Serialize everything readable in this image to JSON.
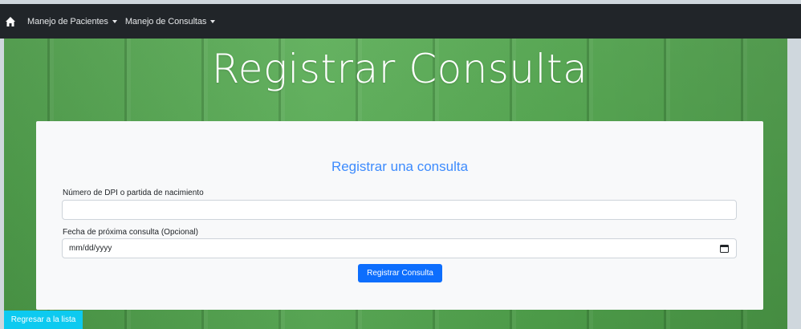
{
  "navbar": {
    "home_icon": "home-icon",
    "items": [
      {
        "label": "Manejo de Pacientes"
      },
      {
        "label": "Manejo de Consultas"
      }
    ]
  },
  "hero": {
    "title": "Registrar Consulta"
  },
  "form": {
    "title": "Registrar una consulta",
    "dpi": {
      "label": "Número de DPI o partida de nacimiento",
      "value": ""
    },
    "date": {
      "label": "Fecha de próxima consulta (Opcional)",
      "value": "mm/dd/yyyy",
      "icon": "calendar-icon"
    },
    "submit_label": "Registrar Consulta"
  },
  "footer": {
    "back_label": "Regresar a la lista"
  },
  "colors": {
    "navbar": "#212529",
    "primary": "#0d6efd",
    "info": "#0dcaf0",
    "card_title": "#3d8bfd",
    "hero_green": "#55a851"
  }
}
